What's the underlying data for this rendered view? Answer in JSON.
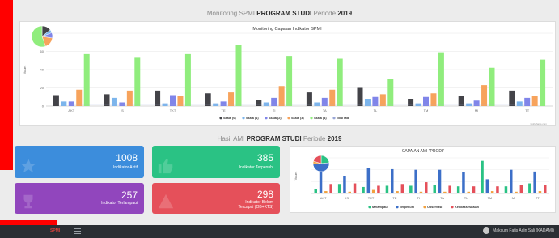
{
  "header": {
    "prefix": "Monitoring SPMI",
    "bold": "PROGRAM STUDI",
    "suffix": "Periode",
    "year": "2019"
  },
  "section2": {
    "prefix": "Hasil AMI",
    "bold": "PROGRAM STUDI",
    "suffix": "Periode",
    "year": "2019"
  },
  "cards": [
    {
      "value": "1008",
      "label": "Indikator Aktif",
      "color": "#3c8ddc"
    },
    {
      "value": "385",
      "label": "Indikator Terpenuhi",
      "color": "#2ac284"
    },
    {
      "value": "257",
      "label": "Indikator Terlampaui",
      "color": "#9146bd"
    },
    {
      "value": "298",
      "label_lines": [
        "Indikator Belum",
        "Tercapai (OB+KTS)"
      ],
      "color": "#e5505a"
    }
  ],
  "footer": {
    "brand": "SPMI",
    "user": "Maksum Fatis Adin Sali (KADAMI)"
  },
  "credit": "highcharts.com",
  "chart_data": [
    {
      "type": "bar",
      "title": "Monitoring Capaian Indikator SPMI",
      "ylabel": "Values",
      "ylim": [
        0,
        80
      ],
      "yticks": [
        0,
        20,
        40,
        60,
        80
      ],
      "categories": [
        "AKT",
        "IS",
        "TKT",
        "TE",
        "TI",
        "TA",
        "TL",
        "TM",
        "MI",
        "TT"
      ],
      "series": [
        {
          "name": "Skala (0)",
          "color": "#434348",
          "values": [
            12,
            13,
            17,
            14,
            7,
            15,
            20,
            8,
            11,
            17
          ]
        },
        {
          "name": "Skala (1)",
          "color": "#7cb5ec",
          "values": [
            5,
            9,
            3,
            3,
            4,
            4,
            8,
            3,
            3,
            5
          ]
        },
        {
          "name": "Skala (2)",
          "color": "#8085e9",
          "values": [
            5,
            4,
            12,
            5,
            9,
            9,
            10,
            10,
            6,
            9
          ]
        },
        {
          "name": "Skala (3)",
          "color": "#f7a35c",
          "values": [
            18,
            17,
            11,
            15,
            22,
            18,
            13,
            14,
            23,
            11
          ]
        },
        {
          "name": "Skala (4)",
          "color": "#90ed7d",
          "values": [
            57,
            53,
            57,
            67,
            55,
            52,
            30,
            59,
            42,
            51
          ]
        }
      ],
      "line": {
        "name": "Nilai rata",
        "color": "#9aa7d6",
        "values": [
          2,
          2,
          2,
          2,
          2,
          2,
          2,
          2,
          2,
          2
        ]
      },
      "legend": "bottom"
    },
    {
      "type": "bar",
      "title": "CAPAIAN AMI \"PRODI\"",
      "ylabel": "Values",
      "ylim": [
        0,
        60
      ],
      "categories": [
        "AKT",
        "IS",
        "TKT",
        "TE",
        "TI",
        "TA",
        "TL",
        "TM",
        "MI",
        "TT"
      ],
      "series": [
        {
          "name": "Melampaui",
          "color": "#2ac284",
          "values": [
            8,
            16,
            11,
            13,
            13,
            14,
            12,
            55,
            12,
            17
          ]
        },
        {
          "name": "Terpenuhi",
          "color": "#3c6fc8",
          "values": [
            46,
            30,
            43,
            41,
            40,
            40,
            36,
            24,
            40,
            37
          ]
        },
        {
          "name": "Observasi",
          "color": "#f2a03d",
          "values": [
            4,
            3,
            6,
            4,
            3,
            3,
            3,
            4,
            3,
            4
          ]
        },
        {
          "name": "Ketidaksesuaian",
          "color": "#e5505a",
          "values": [
            16,
            17,
            13,
            16,
            19,
            13,
            12,
            12,
            14,
            15
          ]
        }
      ],
      "legend": "bottom"
    }
  ]
}
